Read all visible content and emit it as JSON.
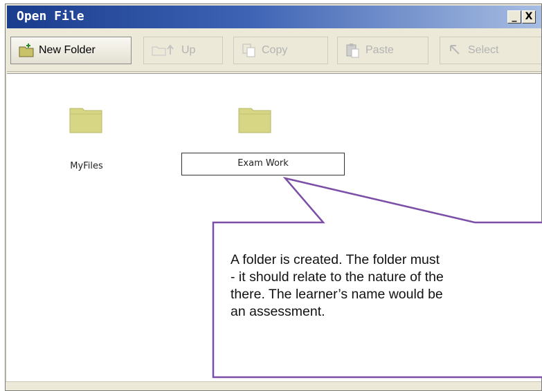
{
  "window": {
    "title": "Open File"
  },
  "controls": {
    "minimize": "_",
    "close": "X"
  },
  "toolbar": {
    "new_folder": "New Folder",
    "up": "Up",
    "copy": "Copy",
    "paste": "Paste",
    "select": "Select"
  },
  "files": {
    "items": [
      {
        "label": "MyFiles"
      }
    ],
    "rename_value": "Exam Work"
  },
  "callout": {
    "lines": [
      "A folder is created. The folder must",
      "- it should relate to the nature of the",
      "there. The learner’s name would be",
      "an assessment."
    ]
  },
  "colors": {
    "title_gradient_start": "#1a3c8c",
    "folder": "#d8d88a",
    "callout_border": "#7b4fa6"
  }
}
